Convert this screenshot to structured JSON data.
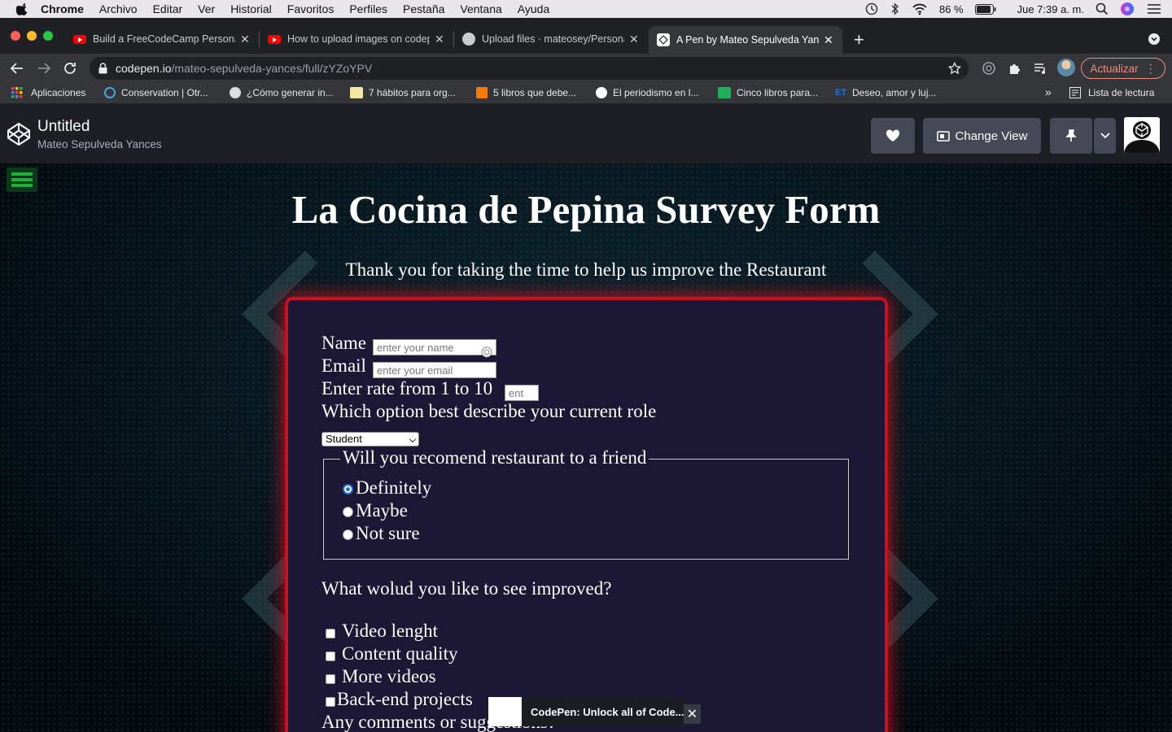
{
  "os_menubar": {
    "app": "Chrome",
    "items": [
      "Archivo",
      "Editar",
      "Ver",
      "Historial",
      "Favoritos",
      "Perfiles",
      "Pestaña",
      "Ventana",
      "Ayuda"
    ],
    "battery": "86 %",
    "clock": "Jue 7:39 a. m."
  },
  "browser": {
    "tabs": [
      {
        "label": "Build a FreeCodeCamp Personal",
        "favicon": "youtube-icon"
      },
      {
        "label": "How to upload images on codepen",
        "favicon": "youtube-icon"
      },
      {
        "label": "Upload files · mateosey/Personal",
        "favicon": "github-icon"
      },
      {
        "label": "A Pen by Mateo Sepulveda Yances",
        "favicon": "codepen-icon",
        "active": true
      }
    ],
    "url_domain": "codepen.io",
    "url_path": "/mateo-sepulveda-yances/full/zYZoYPV",
    "update_label": "Actualizar",
    "bookmarks": [
      {
        "label": "Aplicaciones",
        "color": "#e94235"
      },
      {
        "label": "Conservation | Otr...",
        "color": "#4aa3df"
      },
      {
        "label": "¿Cómo generar in...",
        "color": "#dddddd"
      },
      {
        "label": "7 hábitos para org...",
        "color": "#f4e7a1"
      },
      {
        "label": "5 libros que debe...",
        "color": "#f57c00"
      },
      {
        "label": "El periodismo en l...",
        "color": "#ffffff"
      },
      {
        "label": "Cinco libros para...",
        "color": "#1fb15a"
      },
      {
        "label": "Deseo, amor y luj...",
        "color": "#1a73e8"
      }
    ],
    "more_bookmarks": "»",
    "reading_list": "Lista de lectura"
  },
  "codepen": {
    "pen_title": "Untitled",
    "author": "Mateo Sepulveda Yances",
    "change_view_label": "Change View"
  },
  "survey": {
    "title": "La Cocina de Pepina Survey Form",
    "description": "Thank you for taking the time to help us improve the Restaurant",
    "name_label": "Name",
    "name_placeholder": "enter your name",
    "email_label": "Email",
    "email_placeholder": "enter your email",
    "rate_label": "Enter rate from 1 to 10",
    "rate_placeholder": "ent",
    "role_label": "Which option best describe your current role",
    "role_selected": "Student",
    "recommend_legend": "Will you recomend restaurant to a friend",
    "recommend_options": [
      "Definitely",
      "Maybe",
      "Not sure"
    ],
    "recommend_selected": "Definitely",
    "improve_label": "What wolud you like to see improved?",
    "improve_options": [
      "Video lenght",
      "Content quality",
      "More videos",
      "Back-end projects"
    ],
    "comments_label": "Any comments or suggestions?"
  },
  "toast": {
    "text": "CodePen: Unlock all of Code..."
  },
  "colors": {
    "card_glow": "#c8101e",
    "card_bg": "#1c1735",
    "hamburger": "#1fae3a",
    "update_accent": "#f28b82"
  }
}
